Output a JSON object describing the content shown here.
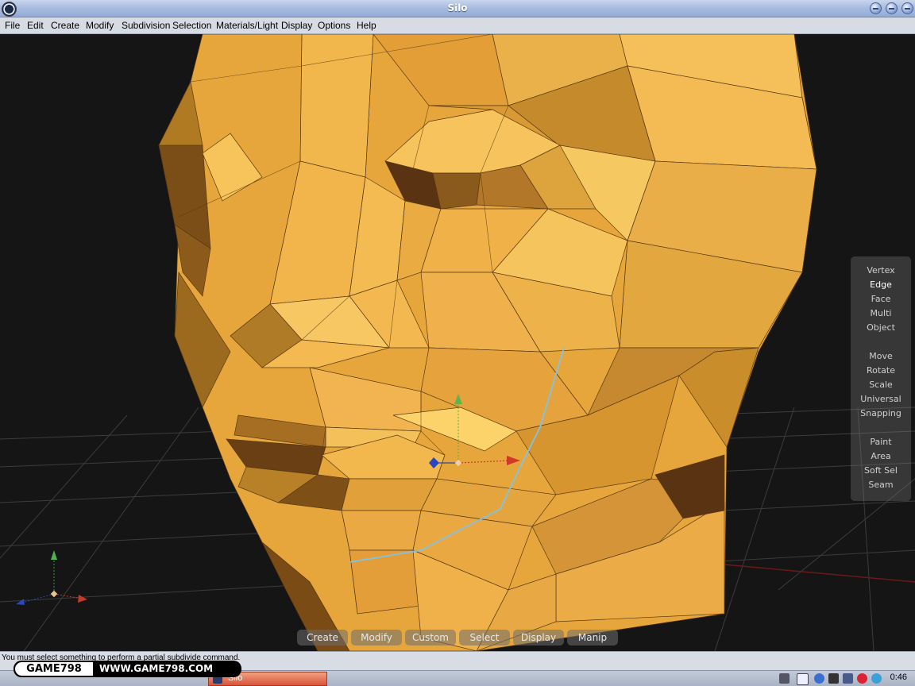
{
  "window": {
    "title": "Silo",
    "controls": [
      "minimize-icon",
      "maximize-icon",
      "close-icon"
    ]
  },
  "menubar": {
    "items": [
      "File",
      "Edit",
      "Create",
      "Modify",
      "Subdivision",
      "Selection",
      "Materials/Light",
      "Display",
      "Options",
      "Help"
    ]
  },
  "selection_panel": {
    "group1": [
      "Vertex",
      "Edge",
      "Face",
      "Multi",
      "Object"
    ],
    "group2": [
      "Move",
      "Rotate",
      "Scale",
      "Universal",
      "Snapping"
    ],
    "group3": [
      "Paint",
      "Area",
      "Soft Sel",
      "Seam"
    ],
    "active": "Edge"
  },
  "bottom_menu": [
    "Create",
    "Modify",
    "Custom",
    "Select",
    "Display",
    "Manip"
  ],
  "status": {
    "message": "You must select something to perform a partial subdivide command."
  },
  "taskbar": {
    "active_task": "Silo",
    "clock": "0:46"
  },
  "watermark": {
    "left": "GAME798",
    "right": "WWW.GAME798.COM"
  },
  "colors": {
    "mesh": "#e7a63c",
    "selected_edge": "#7ec3e8",
    "viewport_bg": "#151515"
  }
}
